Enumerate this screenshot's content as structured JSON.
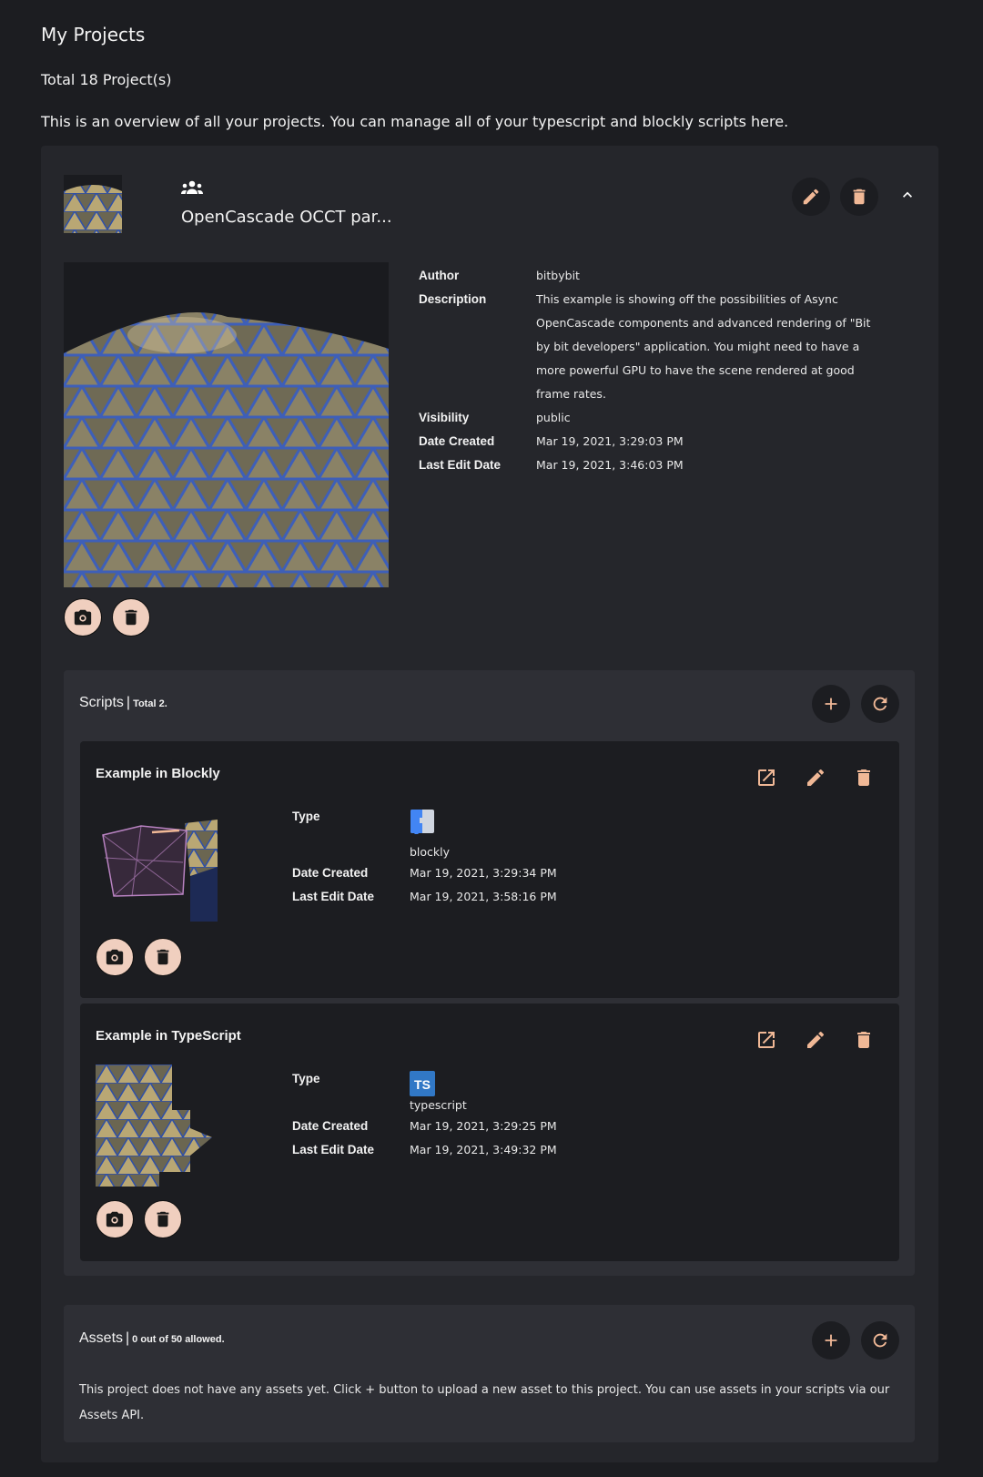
{
  "page": {
    "title": "My Projects",
    "total": "Total 18 Project(s)",
    "intro": "This is an overview of all your projects. You can manage all of your typescript and blockly scripts here."
  },
  "colors": {
    "page_bg": "#1c1d21",
    "card_bg": "#25262b",
    "section_bg": "#2e2f35",
    "accent": "#f0b896",
    "pill_bg": "#f0cfbf"
  },
  "project": {
    "name": "OpenCascade OCCT par...",
    "shared_icon": "people-icon",
    "actions": {
      "edit": "pencil-icon",
      "delete": "trash-icon",
      "collapse": "chevron-up-icon"
    },
    "details": [
      {
        "label": "Author",
        "value": "bitbybit"
      },
      {
        "label": "Description",
        "value": "This example is showing off the possibilities of Async OpenCascade components and advanced rendering of \"Bit by bit developers\" application. You might need to have a more powerful GPU to have the scene rendered at good frame rates."
      },
      {
        "label": "Visibility",
        "value": "public"
      },
      {
        "label": "Date Created",
        "value": "Mar 19, 2021, 3:29:03 PM"
      },
      {
        "label": "Last Edit Date",
        "value": "Mar 19, 2021, 3:46:03 PM"
      }
    ],
    "image_actions": {
      "screenshot": "camera-icon",
      "delete": "trash-icon"
    }
  },
  "scripts": {
    "title": "Scripts",
    "subtitle": "Total 2.",
    "actions": {
      "add": "plus-icon",
      "refresh": "refresh-icon"
    },
    "items": [
      {
        "title": "Example in Blockly",
        "type_label": "Type",
        "type": "blockly",
        "type_icon": "blockly-icon",
        "created_label": "Date Created",
        "created": "Mar 19, 2021, 3:29:34 PM",
        "edited_label": "Last Edit Date",
        "edited": "Mar 19, 2021, 3:58:16 PM"
      },
      {
        "title": "Example in TypeScript",
        "type_label": "Type",
        "type": "typescript",
        "type_icon": "typescript-icon",
        "type_icon_text": "TS",
        "created_label": "Date Created",
        "created": "Mar 19, 2021, 3:29:25 PM",
        "edited_label": "Last Edit Date",
        "edited": "Mar 19, 2021, 3:49:32 PM"
      }
    ]
  },
  "assets": {
    "title": "Assets",
    "subtitle": "0 out of 50 allowed.",
    "empty_text": "This project does not have any assets yet. Click + button to upload a new asset to this project. You can use assets in your scripts via our Assets API.",
    "actions": {
      "add": "plus-icon",
      "refresh": "refresh-icon"
    }
  }
}
